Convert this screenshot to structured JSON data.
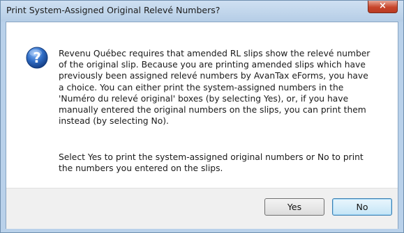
{
  "window": {
    "title": "Print System-Assigned Original Relevé Numbers?",
    "close_label": "×"
  },
  "message": {
    "paragraph1": "Revenu Québec requires that amended RL slips show the relevé number\nof the original slip. Because you are printing amended slips which have\npreviously been assigned relevé numbers by AvanTax eForms, you have\na choice. You can either print the system-assigned numbers in the\n'Numéro du relevé original' boxes (by selecting Yes), or, if you have\nmanually entered the original numbers on the slips, you can print them\ninstead (by selecting No).",
    "paragraph2": "Select Yes to print the system-assigned original numbers or No to print\nthe numbers you entered on the slips.",
    "icon": "question-icon"
  },
  "buttons": {
    "yes_label": "Yes",
    "no_label": "No"
  },
  "colors": {
    "titlebar": "#b9d1ea",
    "close_button": "#c7452b",
    "footer": "#f0f0f0",
    "icon_blue": "#2a5fb0"
  }
}
